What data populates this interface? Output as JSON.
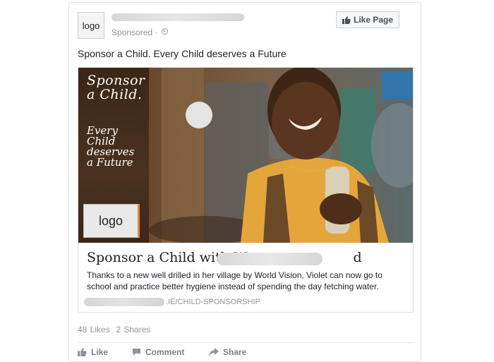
{
  "post": {
    "logo_text": "logo",
    "sponsored_label": "Sponsored · ",
    "like_page_label": "Like Page",
    "text": "Sponsor a Child. Every Child deserves a Future"
  },
  "ad_image": {
    "headline": "Sponsor\na Child.",
    "subline": "Every\nChild\ndeserves\na Future",
    "logo_text": "logo"
  },
  "link": {
    "title": "Sponsor a Child with W",
    "title_tail": "d",
    "description": "Thanks to a new well drilled in her village by World Vision, Violet can now go to school and practice better hygiene instead of spending the day fetching water.",
    "domain": ".IE/CHILD-SPONSORSHIP"
  },
  "stats": {
    "likes": "48 Likes",
    "shares": "2 Shares"
  },
  "actions": [
    {
      "label": "Like",
      "icon": "thumbs-up-icon"
    },
    {
      "label": "Comment",
      "icon": "comment-icon"
    },
    {
      "label": "Share",
      "icon": "share-icon"
    }
  ]
}
